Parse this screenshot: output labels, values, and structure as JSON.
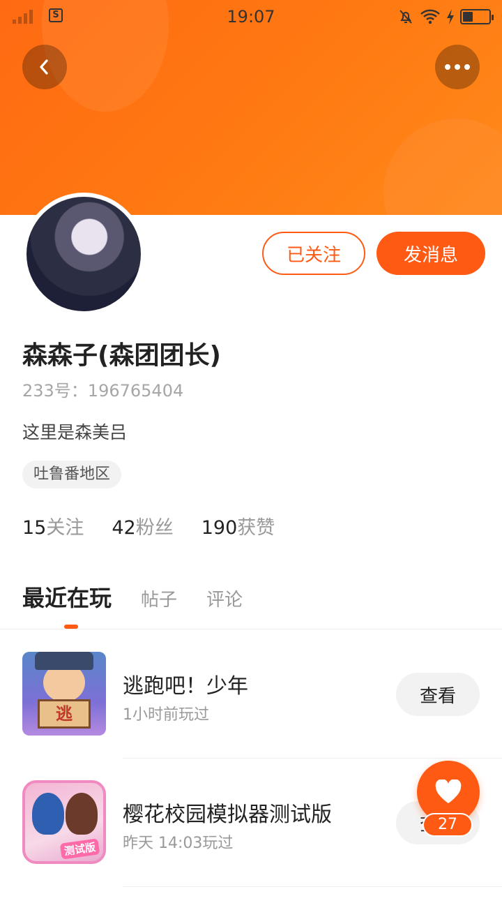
{
  "status_bar": {
    "time": "19:07",
    "carrier_icon": "S"
  },
  "header": {
    "back_icon": "chevron-left-icon",
    "more_icon": "ellipsis-icon"
  },
  "profile": {
    "follow_status_label": "已关注",
    "message_label": "发消息",
    "name": "森森子(森团团长)",
    "uid": "233号：196765404",
    "bio": "这里是森美吕",
    "location": "吐鲁番地区",
    "stats": [
      {
        "value": "15",
        "label": "关注"
      },
      {
        "value": "42",
        "label": "粉丝"
      },
      {
        "value": "190",
        "label": "获赞"
      }
    ]
  },
  "tabs": [
    {
      "label": "最近在玩",
      "active": true
    },
    {
      "label": "帖子",
      "active": false
    },
    {
      "label": "评论",
      "active": false
    }
  ],
  "games": [
    {
      "name": "逃跑吧！少年",
      "time": "1小时前玩过",
      "action": "查看",
      "icon_text": "逃"
    },
    {
      "name": "樱花校园模拟器测试版",
      "time": "昨天 14:03玩过",
      "action": "查看",
      "icon_text": "测试版"
    }
  ],
  "fab": {
    "icon": "heart-icon",
    "count": "27"
  },
  "colors": {
    "accent": "#ff5a14",
    "header_gradient_start": "#ff6a13",
    "header_gradient_end": "#ff8a1c"
  }
}
